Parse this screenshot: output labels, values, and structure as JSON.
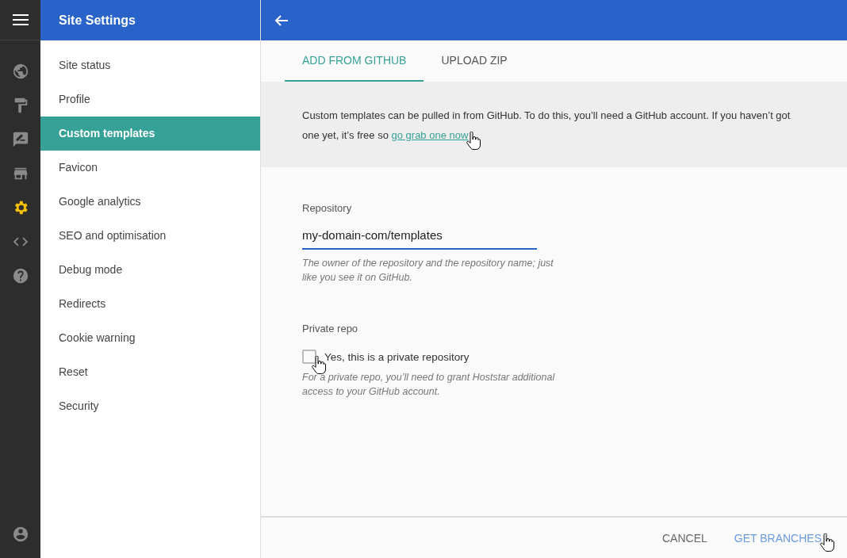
{
  "rail": {
    "items": [
      {
        "kind": "globe",
        "selected": false
      },
      {
        "kind": "roller",
        "selected": false
      },
      {
        "kind": "feedback",
        "selected": false
      },
      {
        "kind": "store",
        "selected": false
      },
      {
        "kind": "gear",
        "selected": true
      },
      {
        "kind": "code",
        "selected": false
      },
      {
        "kind": "help",
        "selected": false
      }
    ]
  },
  "sidebar": {
    "title": "Site Settings",
    "items": [
      {
        "label": "Site status",
        "selected": false
      },
      {
        "label": "Profile",
        "selected": false
      },
      {
        "label": "Custom templates",
        "selected": true
      },
      {
        "label": "Favicon",
        "selected": false
      },
      {
        "label": "Google analytics",
        "selected": false
      },
      {
        "label": "SEO and optimisation",
        "selected": false
      },
      {
        "label": "Debug mode",
        "selected": false
      },
      {
        "label": "Redirects",
        "selected": false
      },
      {
        "label": "Cookie warning",
        "selected": false
      },
      {
        "label": "Reset",
        "selected": false
      },
      {
        "label": "Security",
        "selected": false
      }
    ]
  },
  "tabs": [
    {
      "label": "ADD FROM GITHUB",
      "selected": true
    },
    {
      "label": "UPLOAD ZIP",
      "selected": false
    }
  ],
  "info": {
    "text": "Custom templates can be pulled in from GitHub. To do this, you’ll need a GitHub account. If you haven’t got one yet, it’s free so",
    "link": "go grab one now"
  },
  "repository": {
    "label": "Repository",
    "value": "my-domain-com/templates",
    "hint": "The owner of the repository and the repository name; just like you see it on GitHub."
  },
  "private": {
    "label": "Private repo",
    "checkbox_label": "Yes, this is a private repository",
    "checked": false,
    "hint": "For a private repo, you’ll need to grant Hoststar additional access to your GitHub account."
  },
  "buttons": [
    {
      "label": "CANCEL",
      "kind": "secondary"
    },
    {
      "label": "GET BRANCHES",
      "kind": "primary"
    }
  ]
}
